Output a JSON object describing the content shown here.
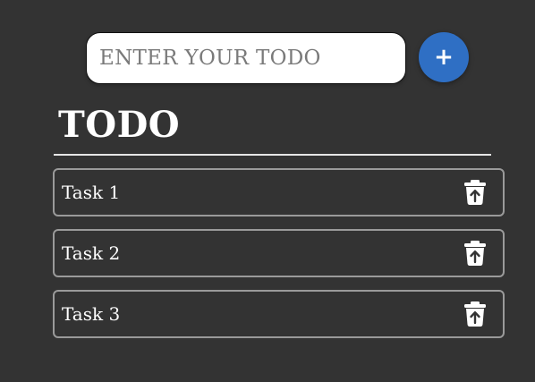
{
  "input": {
    "placeholder": "ENTER YOUR TODO",
    "value": ""
  },
  "add_button": {
    "label": "+",
    "color": "#2f6fc4"
  },
  "title": "TODO",
  "tasks": [
    {
      "label": "Task 1",
      "action_icon": "trash-restore-icon"
    },
    {
      "label": "Task 2",
      "action_icon": "trash-restore-icon"
    },
    {
      "label": "Task 3",
      "action_icon": "trash-restore-icon"
    }
  ],
  "colors": {
    "background": "#333333",
    "task_border": "#9a9a9a",
    "text": "#ffffff"
  }
}
